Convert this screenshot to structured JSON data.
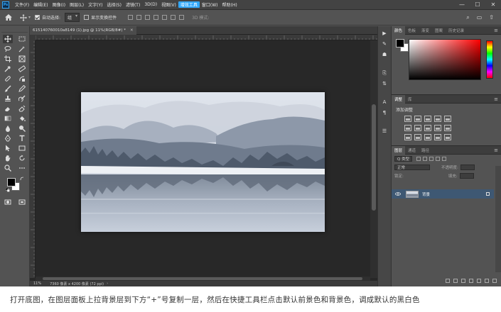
{
  "app": {
    "logo_text": "Ps"
  },
  "menu": {
    "items": [
      "文件(F)",
      "编辑(E)",
      "图像(I)",
      "图层(L)",
      "文字(Y)",
      "选择(S)",
      "滤镜(T)",
      "3D(D)",
      "视图(V)",
      "增效工具",
      "窗口(W)",
      "帮助(H)"
    ],
    "highlighted_index": 9,
    "window_controls": [
      "—",
      "☐",
      "✕"
    ]
  },
  "options": {
    "auto_select_label": "自动选择:",
    "auto_select_target": "组",
    "show_transform_label": "显示变换控件",
    "mode_3d_label": "3D 模式:"
  },
  "document": {
    "tab_title": "615140760010a8149 (1).jpg @ 11%(RGB/8#) *",
    "zoom": "11%",
    "status_info": "7360 像素 x 4200 像素 (72 ppi)"
  },
  "panels": {
    "color_tabs": [
      "颜色",
      "色板",
      "渐变",
      "图案",
      "历史记录"
    ],
    "adjust_tabs": [
      "调整",
      "库"
    ],
    "adjust_title": "添加调整",
    "layers_tabs": [
      "图层",
      "通道",
      "路径"
    ],
    "filter_kind": "Q 类型",
    "blend_mode": "正常",
    "opacity_label": "不透明度:",
    "lock_label": "锁定:",
    "fill_label": "填充:",
    "layer_name": "背景"
  },
  "caption": "打开底图，在图层面板上拉背景层到下方“+”号复制一层，然后在快捷工具栏点击默认前景色和背景色，调成默认的黑白色",
  "colors": {
    "app_bg": "#535353",
    "menubar": "#434343",
    "canvas_bg": "#282828",
    "accent": "#31a8ff",
    "layer_selected": "#3e5873"
  }
}
